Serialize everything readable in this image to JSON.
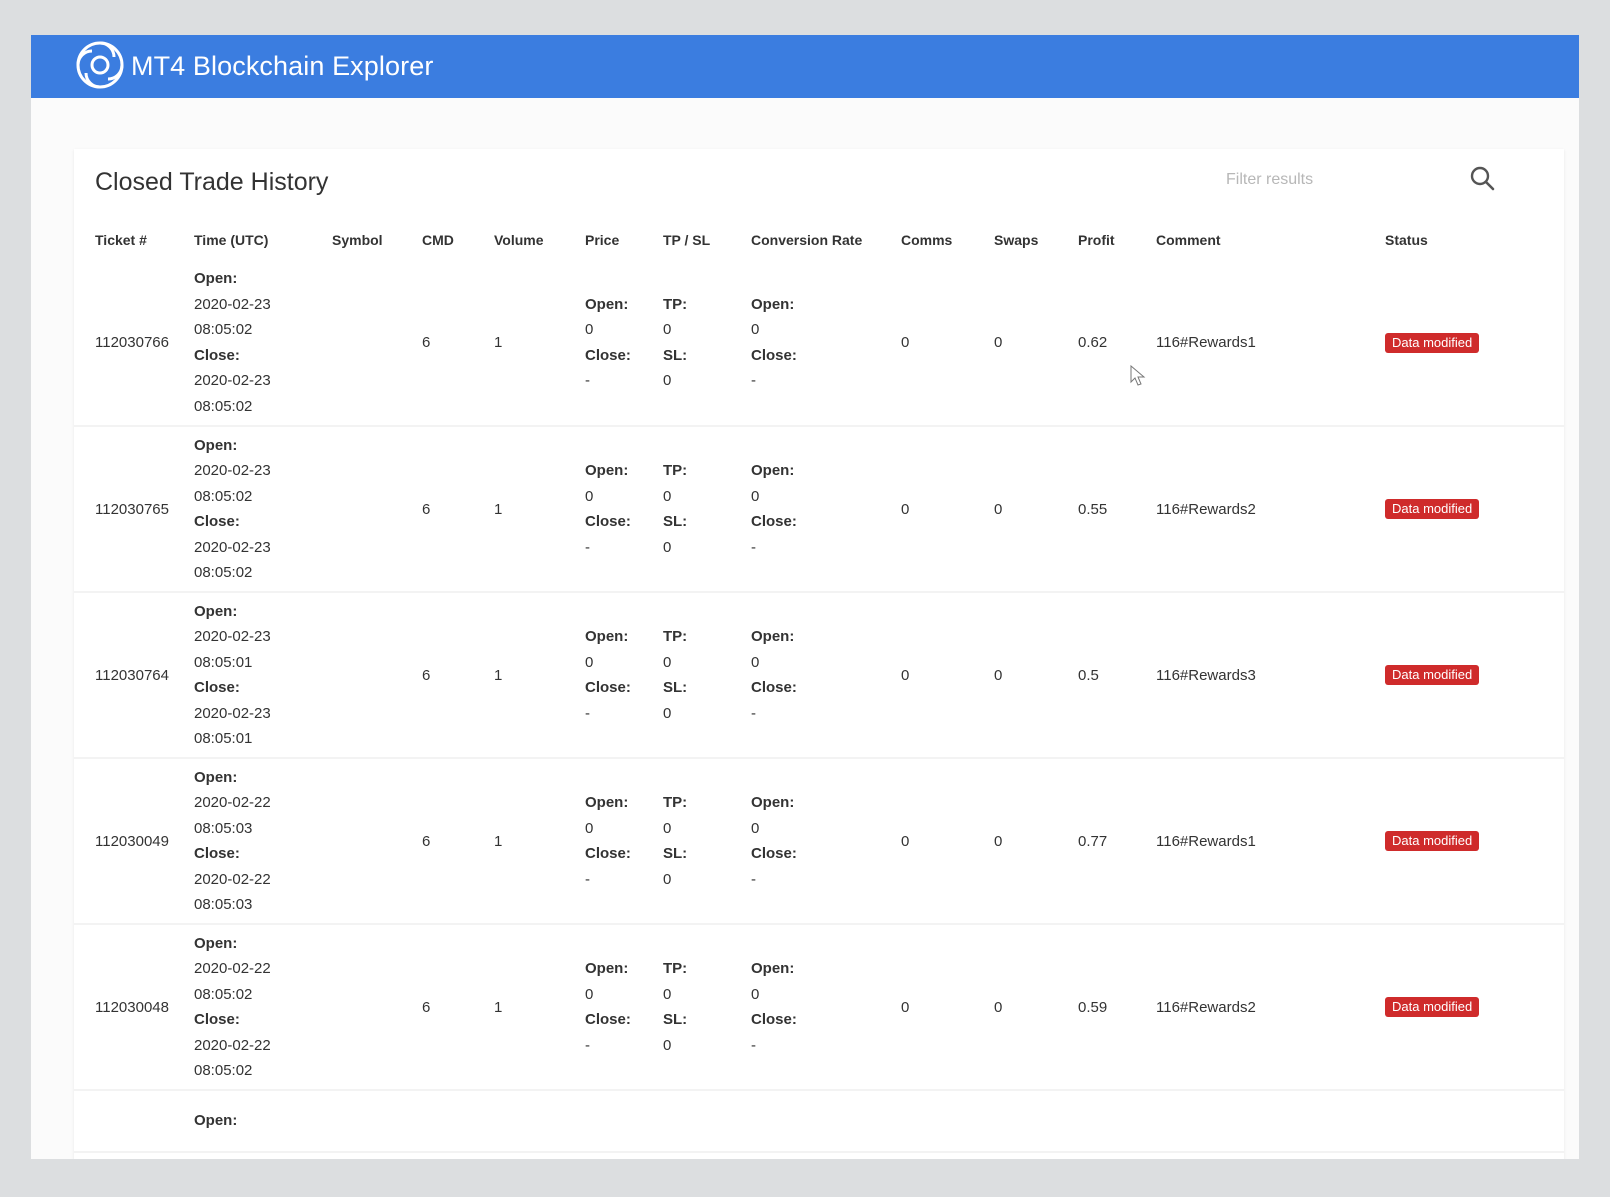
{
  "app": {
    "title": "MT4 Blockchain Explorer",
    "colors": {
      "header": "#3b7de0",
      "status_badge": "#cf2b2b"
    }
  },
  "card": {
    "title": "Closed Trade History",
    "search": {
      "placeholder": "Filter results",
      "value": "",
      "icon": "search-icon"
    }
  },
  "table": {
    "columns": [
      "Ticket #",
      "Time (UTC)",
      "Symbol",
      "CMD",
      "Volume",
      "Price",
      "TP / SL",
      "Conversion Rate",
      "Comms",
      "Swaps",
      "Profit",
      "Comment",
      "Status"
    ],
    "labels": {
      "open": "Open:",
      "close": "Close:",
      "tp": "TP:",
      "sl": "SL:"
    },
    "rows": [
      {
        "ticket": "112030766",
        "open_date": "2020-02-23",
        "open_time": "08:05:02",
        "close_date": "2020-02-23",
        "close_time": "08:05:02",
        "symbol": "",
        "cmd": "6",
        "volume": "1",
        "price_open": "0",
        "price_close": "-",
        "tp": "0",
        "sl": "0",
        "conv_open": "0",
        "conv_close": "-",
        "comms": "0",
        "swaps": "0",
        "profit": "0.62",
        "comment": "116#Rewards1",
        "status": "Data modified"
      },
      {
        "ticket": "112030765",
        "open_date": "2020-02-23",
        "open_time": "08:05:02",
        "close_date": "2020-02-23",
        "close_time": "08:05:02",
        "symbol": "",
        "cmd": "6",
        "volume": "1",
        "price_open": "0",
        "price_close": "-",
        "tp": "0",
        "sl": "0",
        "conv_open": "0",
        "conv_close": "-",
        "comms": "0",
        "swaps": "0",
        "profit": "0.55",
        "comment": "116#Rewards2",
        "status": "Data modified"
      },
      {
        "ticket": "112030764",
        "open_date": "2020-02-23",
        "open_time": "08:05:01",
        "close_date": "2020-02-23",
        "close_time": "08:05:01",
        "symbol": "",
        "cmd": "6",
        "volume": "1",
        "price_open": "0",
        "price_close": "-",
        "tp": "0",
        "sl": "0",
        "conv_open": "0",
        "conv_close": "-",
        "comms": "0",
        "swaps": "0",
        "profit": "0.5",
        "comment": "116#Rewards3",
        "status": "Data modified"
      },
      {
        "ticket": "112030049",
        "open_date": "2020-02-22",
        "open_time": "08:05:03",
        "close_date": "2020-02-22",
        "close_time": "08:05:03",
        "symbol": "",
        "cmd": "6",
        "volume": "1",
        "price_open": "0",
        "price_close": "-",
        "tp": "0",
        "sl": "0",
        "conv_open": "0",
        "conv_close": "-",
        "comms": "0",
        "swaps": "0",
        "profit": "0.77",
        "comment": "116#Rewards1",
        "status": "Data modified"
      },
      {
        "ticket": "112030048",
        "open_date": "2020-02-22",
        "open_time": "08:05:02",
        "close_date": "2020-02-22",
        "close_time": "08:05:02",
        "symbol": "",
        "cmd": "6",
        "volume": "1",
        "price_open": "0",
        "price_close": "-",
        "tp": "0",
        "sl": "0",
        "conv_open": "0",
        "conv_close": "-",
        "comms": "0",
        "swaps": "0",
        "profit": "0.59",
        "comment": "116#Rewards2",
        "status": "Data modified"
      }
    ],
    "partial_row": {
      "open_label": "Open:"
    }
  }
}
